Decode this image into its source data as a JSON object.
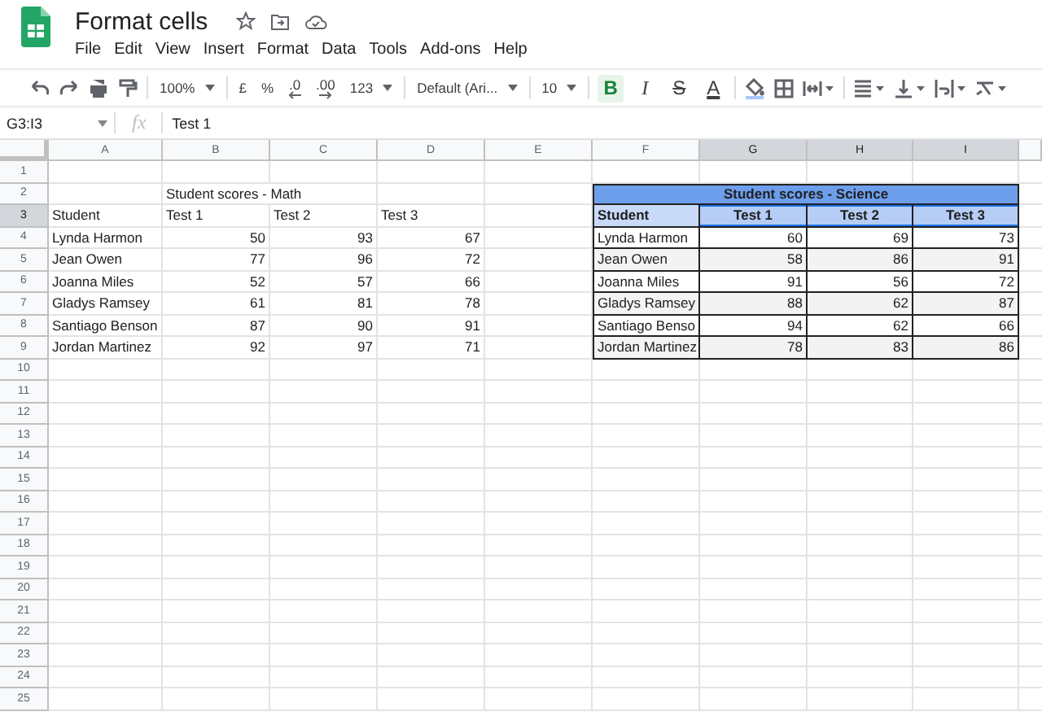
{
  "document": {
    "title": "Format cells"
  },
  "menu": [
    "File",
    "Edit",
    "View",
    "Insert",
    "Format",
    "Data",
    "Tools",
    "Add-ons",
    "Help"
  ],
  "toolbar": [
    [
      {
        "kind": "undo"
      },
      {
        "kind": "redo"
      },
      {
        "kind": "print"
      },
      {
        "kind": "paint"
      }
    ],
    [
      {
        "kind": "dropdown",
        "label": "100%"
      }
    ],
    [
      {
        "kind": "text",
        "label": "£"
      },
      {
        "kind": "text",
        "label": "%"
      },
      {
        "kind": "decrease",
        "label": ".0"
      },
      {
        "kind": "increase",
        "label": ".00"
      },
      {
        "kind": "dropdown",
        "label": "123"
      }
    ],
    [
      {
        "kind": "dropdown",
        "label": "Default (Ari..."
      }
    ],
    [
      {
        "kind": "dropdown",
        "label": "10"
      }
    ],
    [
      {
        "kind": "bold",
        "label": "B",
        "on": true
      },
      {
        "kind": "italic",
        "label": "I",
        "on": false
      },
      {
        "kind": "strike",
        "label": "S",
        "on": false
      },
      {
        "kind": "color",
        "label": "A",
        "on": false
      }
    ],
    [
      {
        "kind": "fill"
      },
      {
        "kind": "borders"
      },
      {
        "kind": "merge"
      }
    ],
    [
      {
        "kind": "halign"
      },
      {
        "kind": "valign"
      },
      {
        "kind": "wrap"
      },
      {
        "kind": "rotate"
      }
    ]
  ],
  "formula_bar": {
    "name_box": "G3:I3",
    "fx": "fx",
    "value": "Test 1"
  },
  "columns": [
    {
      "label": "A",
      "selected": false
    },
    {
      "label": "B",
      "selected": false
    },
    {
      "label": "C",
      "selected": false
    },
    {
      "label": "D",
      "selected": false
    },
    {
      "label": "E",
      "selected": false
    },
    {
      "label": "F",
      "selected": false
    },
    {
      "label": "G",
      "selected": true
    },
    {
      "label": "H",
      "selected": true
    },
    {
      "label": "I",
      "selected": true
    }
  ],
  "rows": [
    {
      "label": "1",
      "selected": false
    },
    {
      "label": "2",
      "selected": false
    },
    {
      "label": "3",
      "selected": true
    },
    {
      "label": "4",
      "selected": false
    },
    {
      "label": "5",
      "selected": false
    },
    {
      "label": "6",
      "selected": false
    },
    {
      "label": "7",
      "selected": false
    },
    {
      "label": "8",
      "selected": false
    },
    {
      "label": "9",
      "selected": false
    },
    {
      "label": "10",
      "selected": false
    },
    {
      "label": "11",
      "selected": false
    },
    {
      "label": "12",
      "selected": false
    },
    {
      "label": "13",
      "selected": false
    },
    {
      "label": "14",
      "selected": false
    },
    {
      "label": "15",
      "selected": false
    },
    {
      "label": "16",
      "selected": false
    },
    {
      "label": "17",
      "selected": false
    },
    {
      "label": "18",
      "selected": false
    },
    {
      "label": "19",
      "selected": false
    },
    {
      "label": "20",
      "selected": false
    },
    {
      "label": "21",
      "selected": false
    },
    {
      "label": "22",
      "selected": false
    },
    {
      "label": "23",
      "selected": false
    },
    {
      "label": "24",
      "selected": false
    },
    {
      "label": "25",
      "selected": false
    }
  ],
  "math_table": {
    "title": "Student scores - Math",
    "headers": [
      {
        "text": "Student",
        "selected": false
      },
      {
        "text": "Test 1",
        "selected": false
      },
      {
        "text": "Test 2",
        "selected": false
      },
      {
        "text": "Test 3",
        "selected": false
      }
    ],
    "rows": [
      {
        "student": "Lynda Harmon",
        "scores": [
          "50",
          "93",
          "67"
        ]
      },
      {
        "student": "Jean Owen",
        "scores": [
          "77",
          "96",
          "72"
        ]
      },
      {
        "student": "Joanna Miles",
        "scores": [
          "52",
          "57",
          "66"
        ]
      },
      {
        "student": "Gladys Ramsey",
        "scores": [
          "61",
          "81",
          "78"
        ]
      },
      {
        "student": "Santiago Benson",
        "scores": [
          "87",
          "90",
          "91"
        ]
      },
      {
        "student": "Jordan Martinez",
        "scores": [
          "92",
          "97",
          "71"
        ]
      }
    ]
  },
  "science_table": {
    "title": "Student scores - Science",
    "headers": [
      {
        "text": "Student",
        "selected": false
      },
      {
        "text": "Test 1",
        "selected": true
      },
      {
        "text": "Test 2",
        "selected": true
      },
      {
        "text": "Test 3",
        "selected": true
      }
    ],
    "rows": [
      {
        "student": "Lynda Harmon",
        "scores": [
          "60",
          "69",
          "73"
        ]
      },
      {
        "student": "Jean Owen",
        "scores": [
          "58",
          "86",
          "91"
        ]
      },
      {
        "student": "Joanna Miles",
        "scores": [
          "91",
          "56",
          "72"
        ]
      },
      {
        "student": "Gladys Ramsey",
        "scores": [
          "88",
          "62",
          "87"
        ]
      },
      {
        "student": "Santiago Benso",
        "scores": [
          "94",
          "62",
          "66"
        ]
      },
      {
        "student": "Jordan Martinez",
        "scores": [
          "78",
          "83",
          "86"
        ]
      }
    ]
  }
}
